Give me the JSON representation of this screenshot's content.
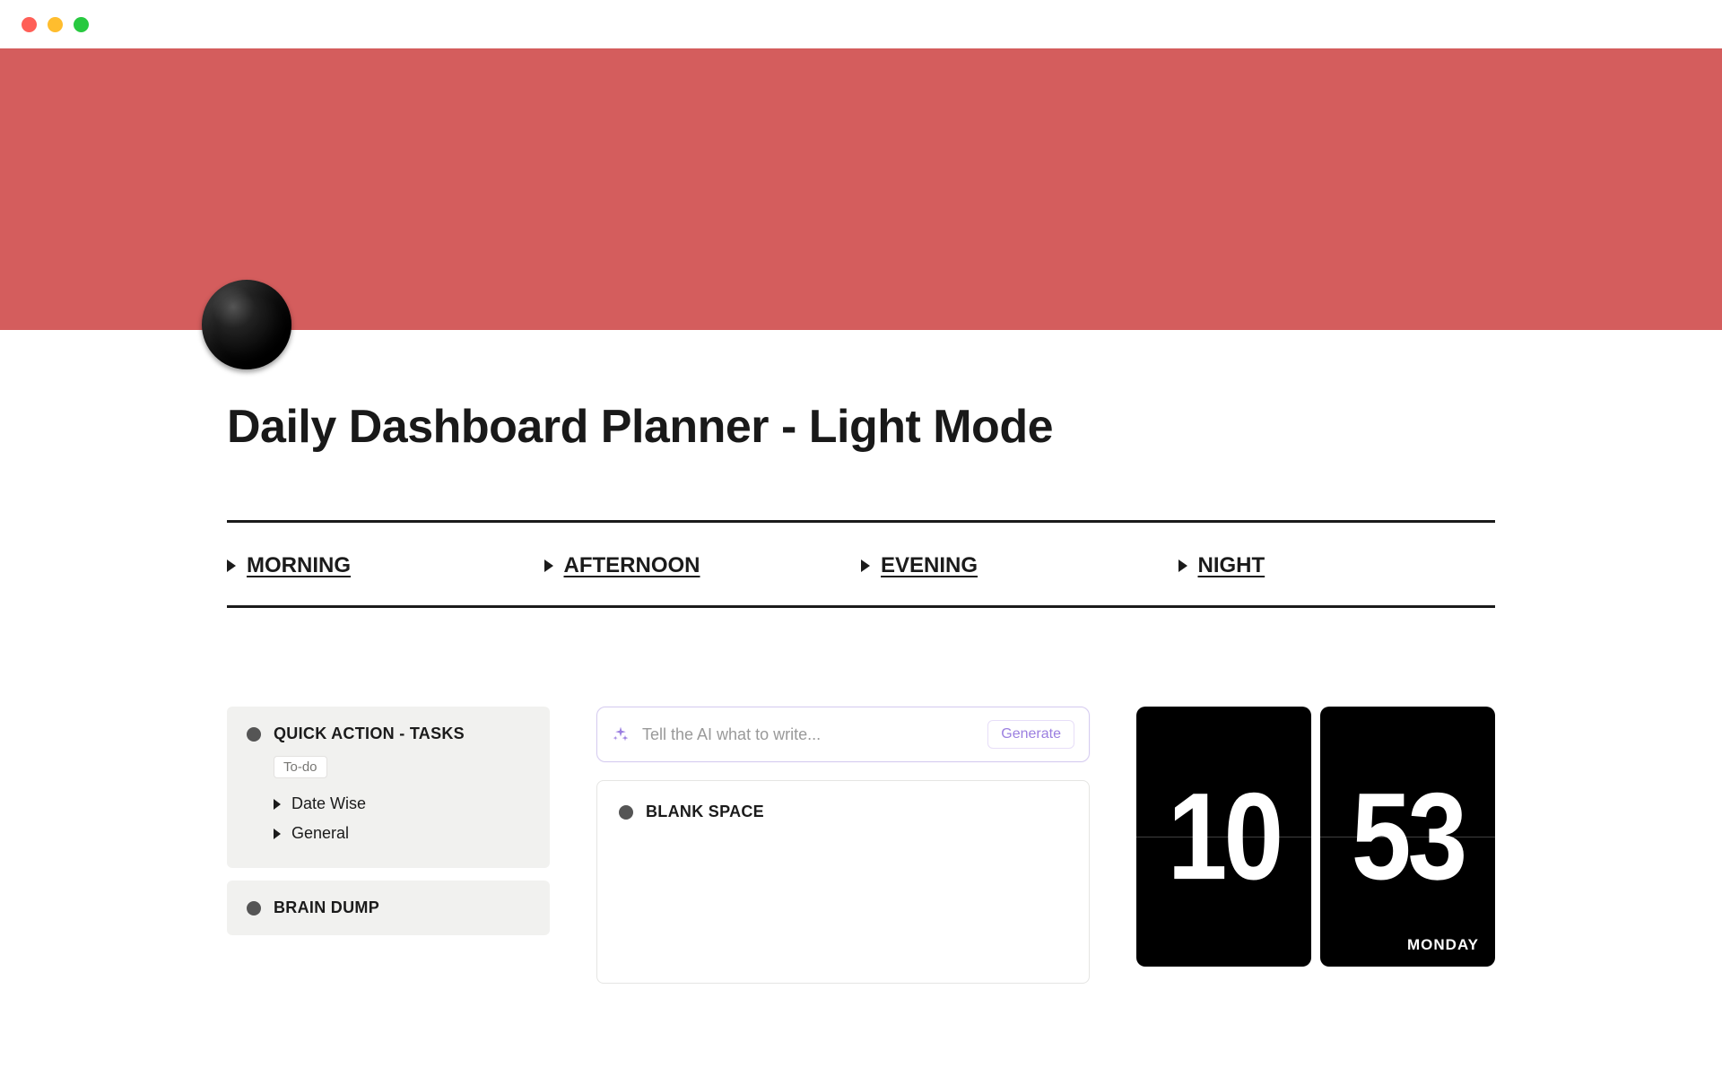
{
  "page": {
    "title": "Daily Dashboard Planner - Light Mode"
  },
  "cover": {
    "color": "#d45d5d"
  },
  "sections": [
    {
      "label": "MORNING"
    },
    {
      "label": "AFTERNOON"
    },
    {
      "label": "EVENING"
    },
    {
      "label": "NIGHT"
    }
  ],
  "sidebar": {
    "quick_action": {
      "title": "QUICK ACTION - TASKS",
      "chip": "To-do",
      "items": [
        {
          "label": "Date Wise"
        },
        {
          "label": "General"
        }
      ]
    },
    "brain_dump": {
      "title": "BRAIN DUMP"
    }
  },
  "ai": {
    "placeholder": "Tell the AI what to write...",
    "button": "Generate"
  },
  "blank": {
    "title": "BLANK SPACE"
  },
  "clock": {
    "hours": "10",
    "minutes": "53",
    "day": "MONDAY"
  }
}
